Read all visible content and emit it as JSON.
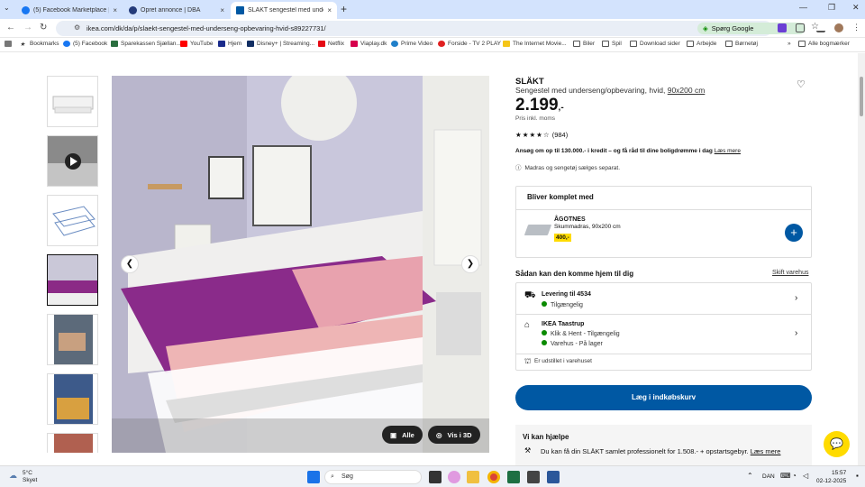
{
  "browser": {
    "tabs": [
      {
        "title": "(5) Facebook Marketplace | Fac",
        "active": false
      },
      {
        "title": "Opret annonce | DBA",
        "active": false
      },
      {
        "title": "SLÄKT sengestel med underses",
        "active": true
      }
    ],
    "url": "ikea.com/dk/da/p/slaekt-sengestel-med-underseng-opbevaring-hvid-s89227731/",
    "search_chip": "Spørg Google",
    "bookmarks": [
      "Bookmarks",
      "(5) Facebook",
      "Sparekassen Sjællan...",
      "YouTube",
      "Hjem",
      "Disney+ | Streaming...",
      "Netflix",
      "Viaplay.dk",
      "Prime Video",
      "Forside - TV 2 PLAY",
      "The Internet Movie...",
      "Biler",
      "Spil",
      "Download sider",
      "Arbejde",
      "Børnetøj"
    ],
    "all_bookmarks": "Alle bogmærker"
  },
  "product": {
    "name": "SLÄKT",
    "desc": "Sengestel med underseng/opbevaring, hvid,",
    "size": "90x200 cm",
    "price_main": "2.199",
    "price_suffix": ",-",
    "price_sub": "Pris inkl. moms",
    "reviews": "(984)",
    "credit": "Ansøg om op til 130.000.- i kredit – og få råd til dine boligdrømme i dag",
    "credit_link": "Læs mere",
    "note": "Madras og sengetøj sælges separat."
  },
  "gallery": {
    "btn_all": "Alle",
    "btn_3d": "Vis i 3D"
  },
  "bundle": {
    "title": "Bliver komplet med",
    "item_name": "ÅGOTNES",
    "item_desc": "Skummadras, 90x200 cm",
    "item_price": "400,-"
  },
  "delivery": {
    "title": "Sådan kan den komme hjem til dig",
    "change": "Skift varehus",
    "ship_title": "Levering til 4534",
    "ship_status": "Tilgængelig",
    "store_title": "IKEA Taastrup",
    "store_status1": "Klik & Hent - Tilgængelig",
    "store_status2": "Varehus - På lager",
    "display": "Er udstillet i varehuset"
  },
  "cart_button": "Læg i indkøbskurv",
  "help": {
    "title": "Vi kan hjælpe",
    "desc": "Du kan få din SLÄKT samlet professionelt for 1.508.- + opstartsgebyr.",
    "link": "Læs mere"
  },
  "taskbar": {
    "temp": "5°C",
    "weather": "Skyet",
    "search": "Søg",
    "lang": "DAN",
    "time": "15:57",
    "date": "02-12-2025"
  }
}
